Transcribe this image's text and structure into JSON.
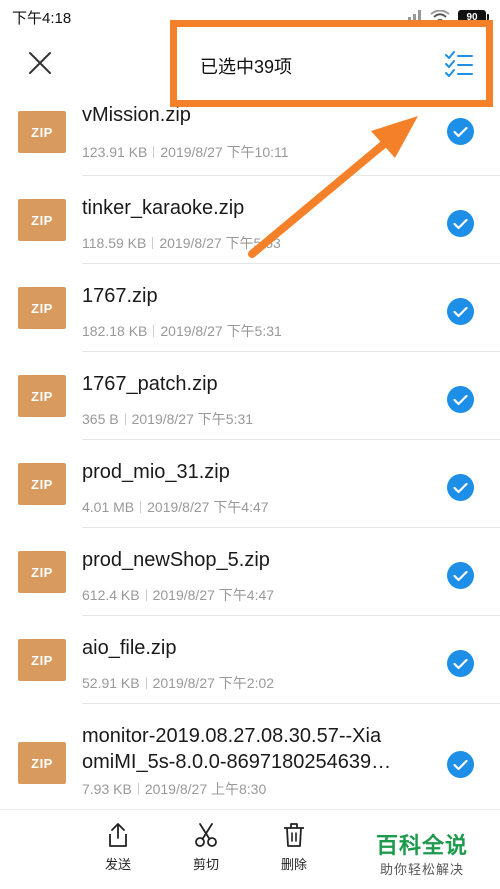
{
  "status_bar": {
    "time": "下午4:18",
    "battery": "90"
  },
  "header": {
    "title": "已选中39项"
  },
  "files": [
    {
      "name": "vMission.zip",
      "size": "123.91 KB",
      "date": "2019/8/27 下午10:11",
      "icon_label": "ZIP",
      "selected": true
    },
    {
      "name": "tinker_karaoke.zip",
      "size": "118.59 KB",
      "date": "2019/8/27 下午5:53",
      "icon_label": "ZIP",
      "selected": true
    },
    {
      "name": "1767.zip",
      "size": "182.18 KB",
      "date": "2019/8/27 下午5:31",
      "icon_label": "ZIP",
      "selected": true
    },
    {
      "name": "1767_patch.zip",
      "size": "365 B",
      "date": "2019/8/27 下午5:31",
      "icon_label": "ZIP",
      "selected": true
    },
    {
      "name": "prod_mio_31.zip",
      "size": "4.01 MB",
      "date": "2019/8/27 下午4:47",
      "icon_label": "ZIP",
      "selected": true
    },
    {
      "name": "prod_newShop_5.zip",
      "size": "612.4 KB",
      "date": "2019/8/27 下午4:47",
      "icon_label": "ZIP",
      "selected": true
    },
    {
      "name": "aio_file.zip",
      "size": "52.91 KB",
      "date": "2019/8/27 下午2:02",
      "icon_label": "ZIP",
      "selected": true
    },
    {
      "name_line1": "monitor-2019.08.27.08.30.57--Xia",
      "name_line2": "omiMI_5s-8.0.0-8697180254639…",
      "size": "7.93 KB",
      "date": "2019/8/27 上午8:30",
      "icon_label": "ZIP",
      "selected": true
    }
  ],
  "bottom_bar": {
    "send_label": "发送",
    "cut_label": "剪切",
    "delete_label": "删除"
  },
  "watermark": {
    "main": "百科全说",
    "sub": "助你轻松解决"
  },
  "colors": {
    "accent": "#1d8fe6",
    "zip_icon": "#d99a5e",
    "highlight": "#f4812a",
    "watermark": "#1d9a4c"
  }
}
